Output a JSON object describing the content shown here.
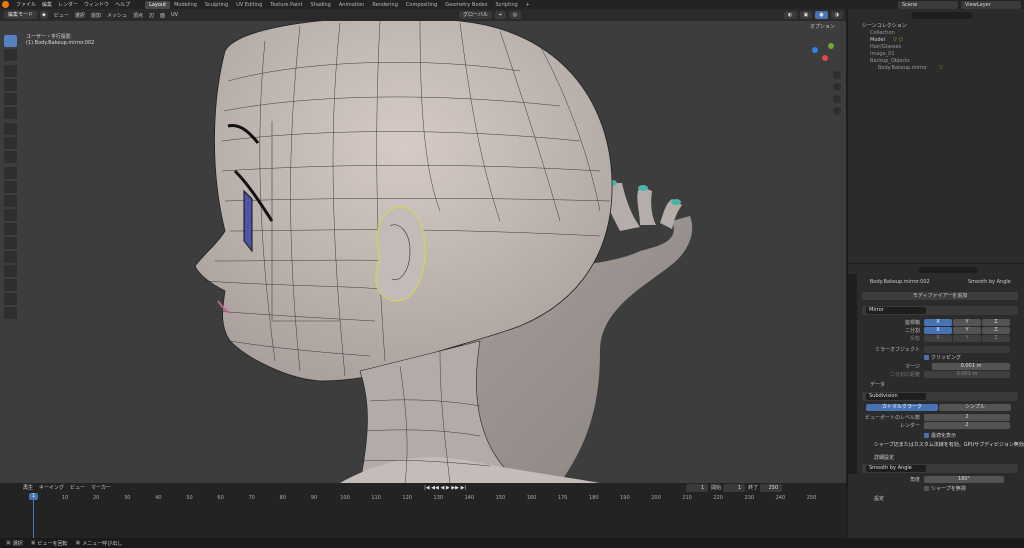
{
  "menu": {
    "items": [
      "ファイル",
      "編集",
      "レンダー",
      "ウィンドウ",
      "ヘルプ"
    ]
  },
  "workspaces": [
    "Layout",
    "Modeling",
    "Sculpting",
    "UV Editing",
    "Texture Paint",
    "Shading",
    "Animation",
    "Rendering",
    "Compositing",
    "Geometry Nodes",
    "Scripting",
    "+"
  ],
  "scene": {
    "name": "Scene",
    "view_layer": "ViewLayer"
  },
  "viewport_header": {
    "mode": "編集モード",
    "menus": [
      "ビュー",
      "選択",
      "追加",
      "メッシュ",
      "頂点",
      "辺",
      "面",
      "UV"
    ],
    "orientation": "グローバル",
    "options": "オプション"
  },
  "viewport": {
    "view_name": "ユーザー・平行投影",
    "object_info": "(1) Body.Bakeup.mirror.002"
  },
  "outliner": {
    "search_placeholder": "",
    "root": "シーンコレクション",
    "items": [
      "Collection",
      "Model",
      "Hair/Glasses",
      "Image_01",
      "Backup_Objects",
      "Body.Bakeup.mirror"
    ]
  },
  "properties": {
    "object_name": "Body.Bakeup.mirror.002",
    "modifier_ref": "Smooth by Angle",
    "add_modifier": "モディファイアーを追加",
    "mirror": {
      "name": "Mirror",
      "axis_label": "座標軸",
      "bisect_label": "二分割",
      "flip_label": "反転",
      "axes": [
        "X",
        "Y",
        "Z"
      ],
      "mirror_object_label": "ミラーオブジェクト",
      "clipping": "クリッピング",
      "merge_label": "マージ",
      "merge_value": "0.001 m",
      "bisect_distance_label": "二分割の距離",
      "bisect_distance_value": "0.001 m",
      "data_label": "データ"
    },
    "subdivision": {
      "name": "Subdivision",
      "tab1": "カトマルクラーク",
      "tab2": "シンプル",
      "viewport_levels_label": "ビューポートのレベル数",
      "viewport_levels": "2",
      "render_label": "レンダー",
      "render": "2",
      "optimal_display": "最適化表示",
      "warning": "シャープ辺またはカスタム法線を有効。GPUサブディビジョン無効",
      "advanced": "詳細設定"
    },
    "smooth": {
      "name": "Smooth by Angle",
      "angle_label": "角度",
      "angle_value": "180°",
      "ignore_sharp": "シャープを無視",
      "layer": "設定"
    }
  },
  "timeline": {
    "menus": [
      "再生",
      "キーイング",
      "ビュー",
      "マーカー"
    ],
    "current_frame": "1",
    "start_label": "開始",
    "start": "1",
    "end_label": "終了",
    "end": "250",
    "ticks": [
      "1",
      "10",
      "20",
      "30",
      "40",
      "50",
      "60",
      "70",
      "80",
      "90",
      "100",
      "110",
      "120",
      "130",
      "140",
      "150",
      "160",
      "170",
      "180",
      "190",
      "200",
      "210",
      "220",
      "230",
      "240",
      "250"
    ]
  },
  "statusbar": {
    "items": [
      "選択",
      "ビューを回転",
      "メニュー呼び出し"
    ]
  },
  "colors": {
    "accent": "#4772b3",
    "brand": "#e87d0d",
    "viewport_bg": "#3d3d3d"
  }
}
